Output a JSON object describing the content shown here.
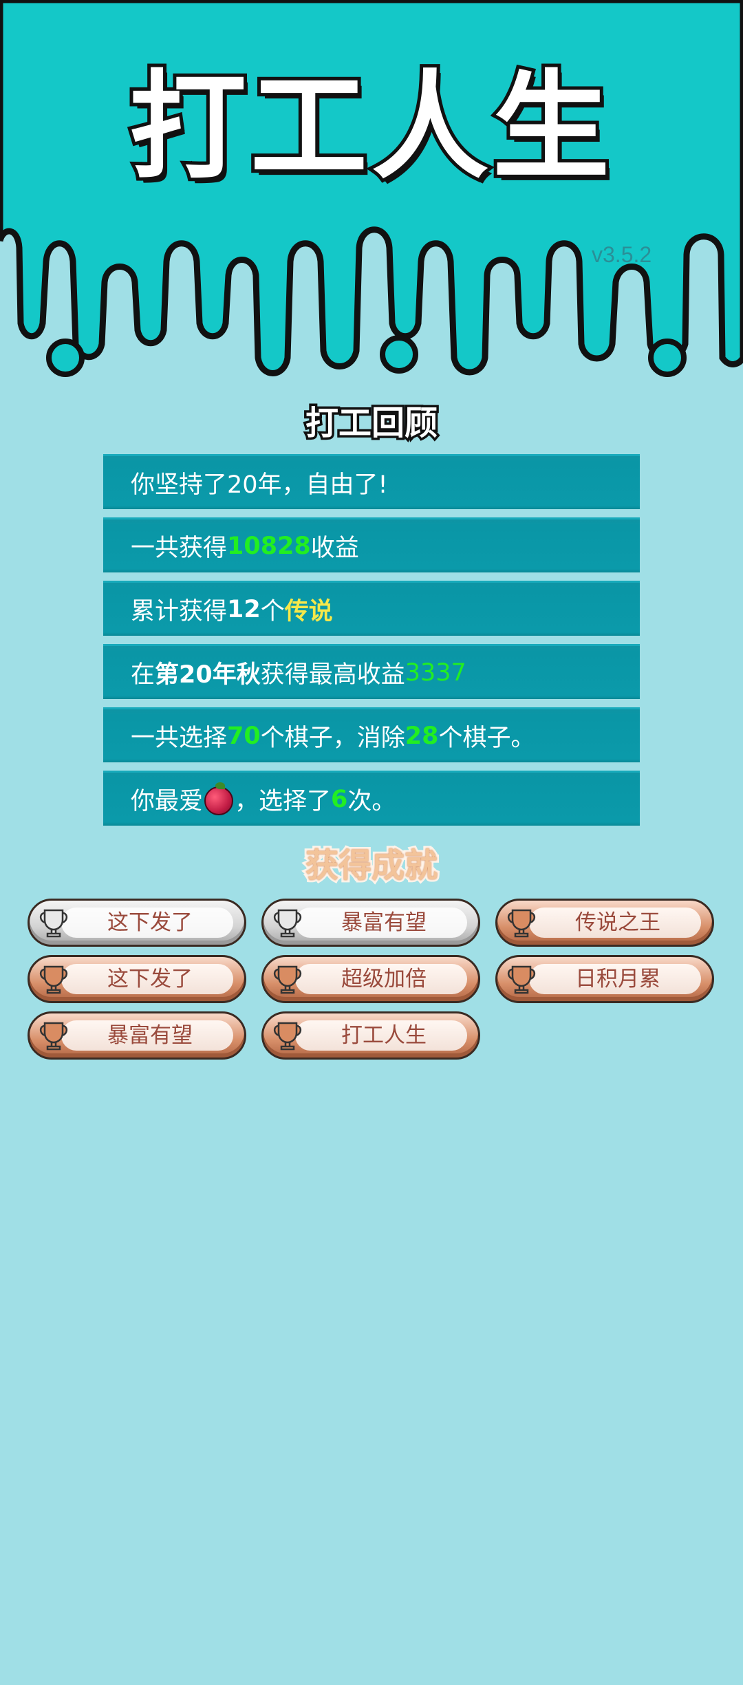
{
  "header": {
    "title": "打工人生",
    "version": "v3.5.2"
  },
  "colors": {
    "header_teal": "#14c8c8",
    "background": "#a0dfe6",
    "row_bg": "#0b9aaa",
    "highlight_green": "#22ee22",
    "highlight_gold": "#f6e84a"
  },
  "review": {
    "title": "打工回顾",
    "rows": {
      "r1": {
        "text": "你坚持了20年，自由了!"
      },
      "r2": {
        "pre": "一共获得",
        "value": "10828",
        "post": "收益"
      },
      "r3": {
        "pre": "累计获得",
        "count": "12",
        "mid": "个",
        "rarity": "传说"
      },
      "r4": {
        "pre": "在 ",
        "season": "第20年秋",
        "mid": " 获得最高收益",
        "value": "3337"
      },
      "r5": {
        "pre": "一共选择",
        "picked": "70",
        "mid": "个棋子，消除",
        "removed": "28",
        "post": "个棋子。"
      },
      "r6": {
        "pre": "你最爱",
        "fruit_icon": "lychee-icon",
        "mid": "，选择了",
        "times": "6",
        "post": "次。"
      }
    }
  },
  "achievements": {
    "title": "获得成就",
    "items": [
      {
        "label": "这下发了",
        "tier": "silver"
      },
      {
        "label": "暴富有望",
        "tier": "silver"
      },
      {
        "label": "传说之王",
        "tier": "bronze"
      },
      {
        "label": "这下发了",
        "tier": "bronze"
      },
      {
        "label": "超级加倍",
        "tier": "bronze"
      },
      {
        "label": "日积月累",
        "tier": "bronze"
      },
      {
        "label": "暴富有望",
        "tier": "bronze"
      },
      {
        "label": "打工人生",
        "tier": "bronze"
      }
    ]
  }
}
